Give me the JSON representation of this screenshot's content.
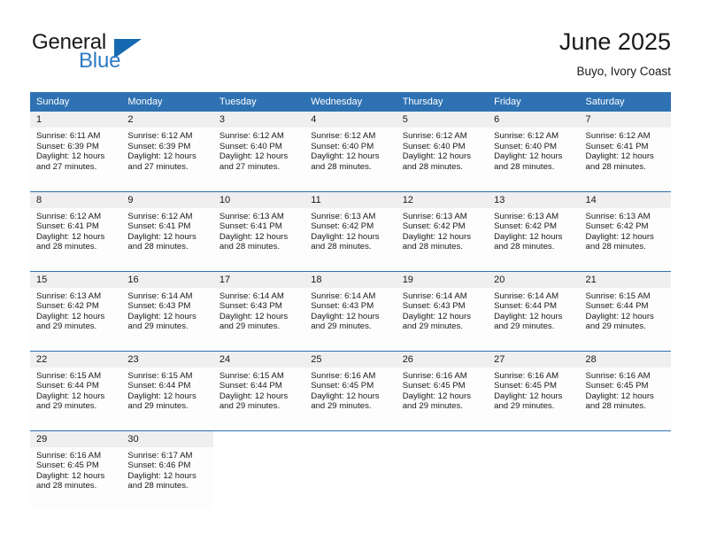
{
  "brand": {
    "name_part1": "General",
    "name_part2": "Blue",
    "triangle_icon": "blue-triangle-icon",
    "accent_color": "#2e7ac4",
    "header_color": "#2e72b3"
  },
  "header": {
    "title": "June 2025",
    "subtitle": "Buyo, Ivory Coast"
  },
  "calendar": {
    "weekday_headers": [
      "Sunday",
      "Monday",
      "Tuesday",
      "Wednesday",
      "Thursday",
      "Friday",
      "Saturday"
    ],
    "weeks": [
      [
        {
          "day": "1",
          "sunrise": "Sunrise: 6:11 AM",
          "sunset": "Sunset: 6:39 PM",
          "daylight_line1": "Daylight: 12 hours",
          "daylight_line2": "and 27 minutes."
        },
        {
          "day": "2",
          "sunrise": "Sunrise: 6:12 AM",
          "sunset": "Sunset: 6:39 PM",
          "daylight_line1": "Daylight: 12 hours",
          "daylight_line2": "and 27 minutes."
        },
        {
          "day": "3",
          "sunrise": "Sunrise: 6:12 AM",
          "sunset": "Sunset: 6:40 PM",
          "daylight_line1": "Daylight: 12 hours",
          "daylight_line2": "and 27 minutes."
        },
        {
          "day": "4",
          "sunrise": "Sunrise: 6:12 AM",
          "sunset": "Sunset: 6:40 PM",
          "daylight_line1": "Daylight: 12 hours",
          "daylight_line2": "and 28 minutes."
        },
        {
          "day": "5",
          "sunrise": "Sunrise: 6:12 AM",
          "sunset": "Sunset: 6:40 PM",
          "daylight_line1": "Daylight: 12 hours",
          "daylight_line2": "and 28 minutes."
        },
        {
          "day": "6",
          "sunrise": "Sunrise: 6:12 AM",
          "sunset": "Sunset: 6:40 PM",
          "daylight_line1": "Daylight: 12 hours",
          "daylight_line2": "and 28 minutes."
        },
        {
          "day": "7",
          "sunrise": "Sunrise: 6:12 AM",
          "sunset": "Sunset: 6:41 PM",
          "daylight_line1": "Daylight: 12 hours",
          "daylight_line2": "and 28 minutes."
        }
      ],
      [
        {
          "day": "8",
          "sunrise": "Sunrise: 6:12 AM",
          "sunset": "Sunset: 6:41 PM",
          "daylight_line1": "Daylight: 12 hours",
          "daylight_line2": "and 28 minutes."
        },
        {
          "day": "9",
          "sunrise": "Sunrise: 6:12 AM",
          "sunset": "Sunset: 6:41 PM",
          "daylight_line1": "Daylight: 12 hours",
          "daylight_line2": "and 28 minutes."
        },
        {
          "day": "10",
          "sunrise": "Sunrise: 6:13 AM",
          "sunset": "Sunset: 6:41 PM",
          "daylight_line1": "Daylight: 12 hours",
          "daylight_line2": "and 28 minutes."
        },
        {
          "day": "11",
          "sunrise": "Sunrise: 6:13 AM",
          "sunset": "Sunset: 6:42 PM",
          "daylight_line1": "Daylight: 12 hours",
          "daylight_line2": "and 28 minutes."
        },
        {
          "day": "12",
          "sunrise": "Sunrise: 6:13 AM",
          "sunset": "Sunset: 6:42 PM",
          "daylight_line1": "Daylight: 12 hours",
          "daylight_line2": "and 28 minutes."
        },
        {
          "day": "13",
          "sunrise": "Sunrise: 6:13 AM",
          "sunset": "Sunset: 6:42 PM",
          "daylight_line1": "Daylight: 12 hours",
          "daylight_line2": "and 28 minutes."
        },
        {
          "day": "14",
          "sunrise": "Sunrise: 6:13 AM",
          "sunset": "Sunset: 6:42 PM",
          "daylight_line1": "Daylight: 12 hours",
          "daylight_line2": "and 28 minutes."
        }
      ],
      [
        {
          "day": "15",
          "sunrise": "Sunrise: 6:13 AM",
          "sunset": "Sunset: 6:42 PM",
          "daylight_line1": "Daylight: 12 hours",
          "daylight_line2": "and 29 minutes."
        },
        {
          "day": "16",
          "sunrise": "Sunrise: 6:14 AM",
          "sunset": "Sunset: 6:43 PM",
          "daylight_line1": "Daylight: 12 hours",
          "daylight_line2": "and 29 minutes."
        },
        {
          "day": "17",
          "sunrise": "Sunrise: 6:14 AM",
          "sunset": "Sunset: 6:43 PM",
          "daylight_line1": "Daylight: 12 hours",
          "daylight_line2": "and 29 minutes."
        },
        {
          "day": "18",
          "sunrise": "Sunrise: 6:14 AM",
          "sunset": "Sunset: 6:43 PM",
          "daylight_line1": "Daylight: 12 hours",
          "daylight_line2": "and 29 minutes."
        },
        {
          "day": "19",
          "sunrise": "Sunrise: 6:14 AM",
          "sunset": "Sunset: 6:43 PM",
          "daylight_line1": "Daylight: 12 hours",
          "daylight_line2": "and 29 minutes."
        },
        {
          "day": "20",
          "sunrise": "Sunrise: 6:14 AM",
          "sunset": "Sunset: 6:44 PM",
          "daylight_line1": "Daylight: 12 hours",
          "daylight_line2": "and 29 minutes."
        },
        {
          "day": "21",
          "sunrise": "Sunrise: 6:15 AM",
          "sunset": "Sunset: 6:44 PM",
          "daylight_line1": "Daylight: 12 hours",
          "daylight_line2": "and 29 minutes."
        }
      ],
      [
        {
          "day": "22",
          "sunrise": "Sunrise: 6:15 AM",
          "sunset": "Sunset: 6:44 PM",
          "daylight_line1": "Daylight: 12 hours",
          "daylight_line2": "and 29 minutes."
        },
        {
          "day": "23",
          "sunrise": "Sunrise: 6:15 AM",
          "sunset": "Sunset: 6:44 PM",
          "daylight_line1": "Daylight: 12 hours",
          "daylight_line2": "and 29 minutes."
        },
        {
          "day": "24",
          "sunrise": "Sunrise: 6:15 AM",
          "sunset": "Sunset: 6:44 PM",
          "daylight_line1": "Daylight: 12 hours",
          "daylight_line2": "and 29 minutes."
        },
        {
          "day": "25",
          "sunrise": "Sunrise: 6:16 AM",
          "sunset": "Sunset: 6:45 PM",
          "daylight_line1": "Daylight: 12 hours",
          "daylight_line2": "and 29 minutes."
        },
        {
          "day": "26",
          "sunrise": "Sunrise: 6:16 AM",
          "sunset": "Sunset: 6:45 PM",
          "daylight_line1": "Daylight: 12 hours",
          "daylight_line2": "and 29 minutes."
        },
        {
          "day": "27",
          "sunrise": "Sunrise: 6:16 AM",
          "sunset": "Sunset: 6:45 PM",
          "daylight_line1": "Daylight: 12 hours",
          "daylight_line2": "and 29 minutes."
        },
        {
          "day": "28",
          "sunrise": "Sunrise: 6:16 AM",
          "sunset": "Sunset: 6:45 PM",
          "daylight_line1": "Daylight: 12 hours",
          "daylight_line2": "and 28 minutes."
        }
      ],
      [
        {
          "day": "29",
          "sunrise": "Sunrise: 6:16 AM",
          "sunset": "Sunset: 6:45 PM",
          "daylight_line1": "Daylight: 12 hours",
          "daylight_line2": "and 28 minutes."
        },
        {
          "day": "30",
          "sunrise": "Sunrise: 6:17 AM",
          "sunset": "Sunset: 6:46 PM",
          "daylight_line1": "Daylight: 12 hours",
          "daylight_line2": "and 28 minutes."
        },
        null,
        null,
        null,
        null,
        null
      ]
    ]
  }
}
